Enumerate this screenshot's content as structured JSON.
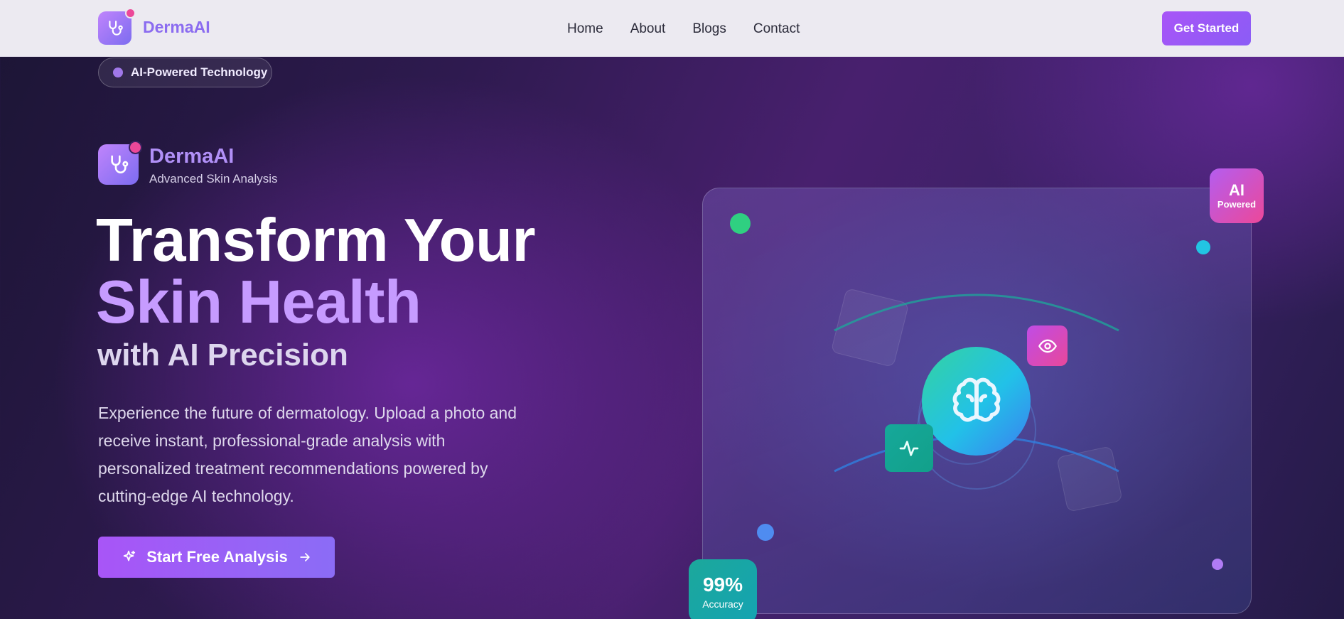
{
  "navbar": {
    "brand": "DermaAI",
    "links": [
      "Home",
      "About",
      "Blogs",
      "Contact"
    ],
    "cta": "Get Started"
  },
  "hero": {
    "badge": "AI-Powered Technology",
    "brand": "DermaAI",
    "brand_subtitle": "Advanced Skin Analysis",
    "headline_line1": "Transform Your",
    "headline_line2": "Skin Health",
    "headline_line3": "with AI Precision",
    "description": "Experience the future of dermatology. Upload a photo and receive instant, professional-grade analysis with personalized treatment recommendations powered by cutting-edge AI technology.",
    "cta": "Start Free Analysis"
  },
  "visual": {
    "ai_badge_title": "AI",
    "ai_badge_subtitle": "Powered",
    "accuracy_value": "99%",
    "accuracy_label": "Accuracy",
    "icons": [
      "brain-icon",
      "eye-icon",
      "activity-icon",
      "sparkles-icon",
      "stethoscope-icon",
      "arrow-right-icon"
    ]
  },
  "colors": {
    "primary": "#a855f7",
    "accent_violet": "#8b5cf6",
    "accent_pink": "#ec4899",
    "accent_teal": "#14b8a6",
    "accent_cyan": "#22d3ee"
  }
}
